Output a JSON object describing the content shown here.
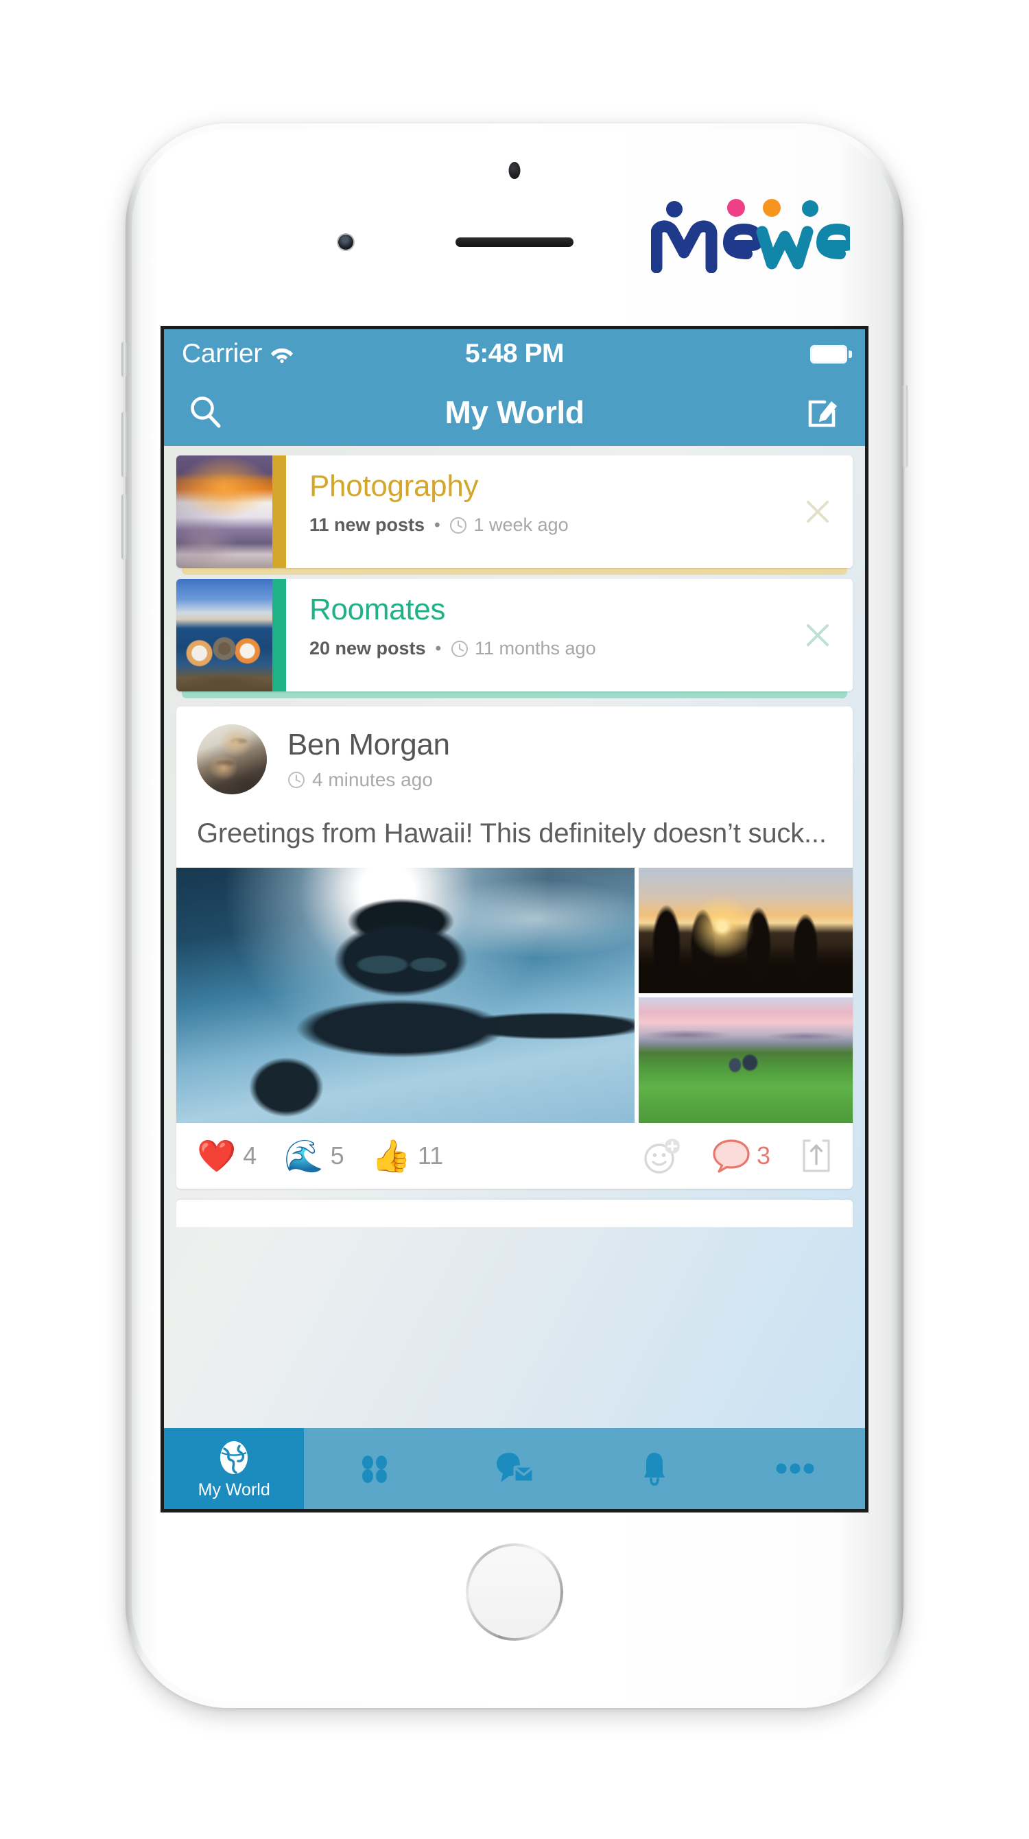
{
  "brand": {
    "logo_text_left": "Me",
    "logo_text_right": "We",
    "colors": {
      "navy": "#1f3a8a",
      "pink": "#ef3f87",
      "orange": "#f7941e",
      "teal": "#1186a8",
      "nav_blue": "#4d9ec5",
      "tab_blue": "#5aa7ca",
      "tab_active_blue": "#1b8cbd",
      "gold": "#d4a72c",
      "green": "#1fb286",
      "comment_red": "#e8786e"
    }
  },
  "status_bar": {
    "carrier": "Carrier",
    "time": "5:48 PM",
    "wifi_icon": "wifi-icon",
    "battery_icon": "battery-full-icon"
  },
  "nav_bar": {
    "title": "My World",
    "search_icon": "search-icon",
    "compose_icon": "compose-icon"
  },
  "group_invites": [
    {
      "name": "Photography",
      "new_posts": "11 new posts",
      "separator": "•",
      "time_ago": "1 week ago",
      "clock_icon": "clock-icon",
      "close_icon": "close-icon",
      "accent_color": "#d4a72c",
      "band_color": "#ecd9a0",
      "thumb_alt": "desert-arch-photo"
    },
    {
      "name": "Roomates",
      "new_posts": "20 new posts",
      "separator": "•",
      "time_ago": "11 months ago",
      "clock_icon": "clock-icon",
      "close_icon": "close-icon",
      "accent_color": "#1fb286",
      "band_color": "#9ddcc8",
      "thumb_alt": "friends-on-cliff-photo"
    }
  ],
  "post": {
    "author": "Ben Morgan",
    "time_ago": "4 minutes ago",
    "clock_icon": "clock-icon",
    "avatar_alt": "couple-selfie-avatar",
    "text": "Greetings from Hawaii! This definitely doesn’t suck...",
    "media": [
      {
        "alt": "underwater-snorkel-selfie",
        "position": "main"
      },
      {
        "alt": "sunset-skateboard-silhouettes",
        "position": "side-top"
      },
      {
        "alt": "couple-on-golf-course",
        "position": "side-bottom"
      }
    ],
    "reactions": [
      {
        "emoji": "❤️",
        "name": "heart-reaction",
        "count": "4"
      },
      {
        "emoji": "🌊",
        "name": "wave-reaction",
        "count": "5"
      },
      {
        "emoji": "👍",
        "name": "thumbs-up-reaction",
        "count": "11"
      }
    ],
    "add_reaction_icon": "add-emoji-icon",
    "comment_icon": "comment-bubble-icon",
    "comment_count": "3",
    "share_icon": "share-icon"
  },
  "tab_bar": {
    "items": [
      {
        "label": "My World",
        "icon": "globe-icon",
        "active": true
      },
      {
        "label": "",
        "icon": "groups-grid-icon",
        "active": false
      },
      {
        "label": "",
        "icon": "chat-mail-icon",
        "active": false
      },
      {
        "label": "",
        "icon": "bell-icon",
        "active": false
      },
      {
        "label": "",
        "icon": "more-dots-icon",
        "active": false
      }
    ]
  }
}
